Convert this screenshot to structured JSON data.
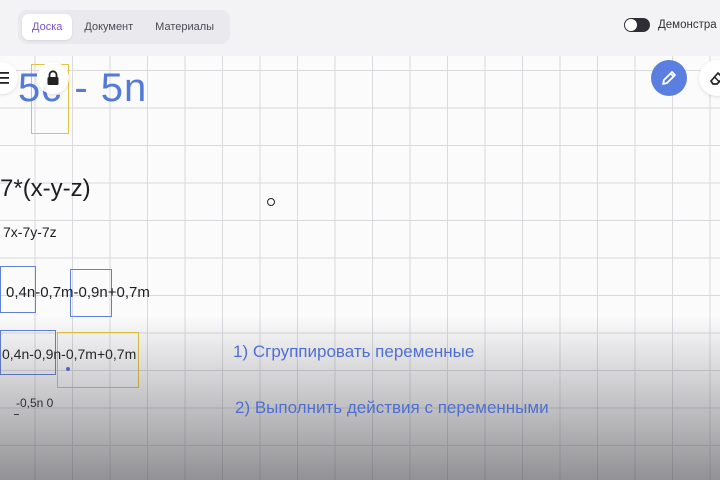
{
  "tabs": [
    {
      "label": "Доска"
    },
    {
      "label": "Документ"
    },
    {
      "label": "Материалы"
    }
  ],
  "demo": {
    "label": "Демонстра",
    "enabled": false
  },
  "board": {
    "heading": "5c - 5n",
    "equation": "7*(x-y-z)",
    "expansion": "7x-7y-7z",
    "row1": "0,4n-0,7m-0,9n+0,7m",
    "row2": "0,4n-0,9n-0,7m+0,7m",
    "row3": "-0,5n 0",
    "step1": "1) Сгруппировать переменные",
    "step2": "2) Выполнить действия с переменными"
  },
  "icons": {
    "menu": "menu-icon",
    "lock": "lock-icon",
    "pen": "pen-icon",
    "eraser": "eraser-icon"
  },
  "colors": {
    "accent": "#5b7fe0",
    "highlight_box": "#e0c440",
    "active_tab_text": "#7a52c7"
  }
}
